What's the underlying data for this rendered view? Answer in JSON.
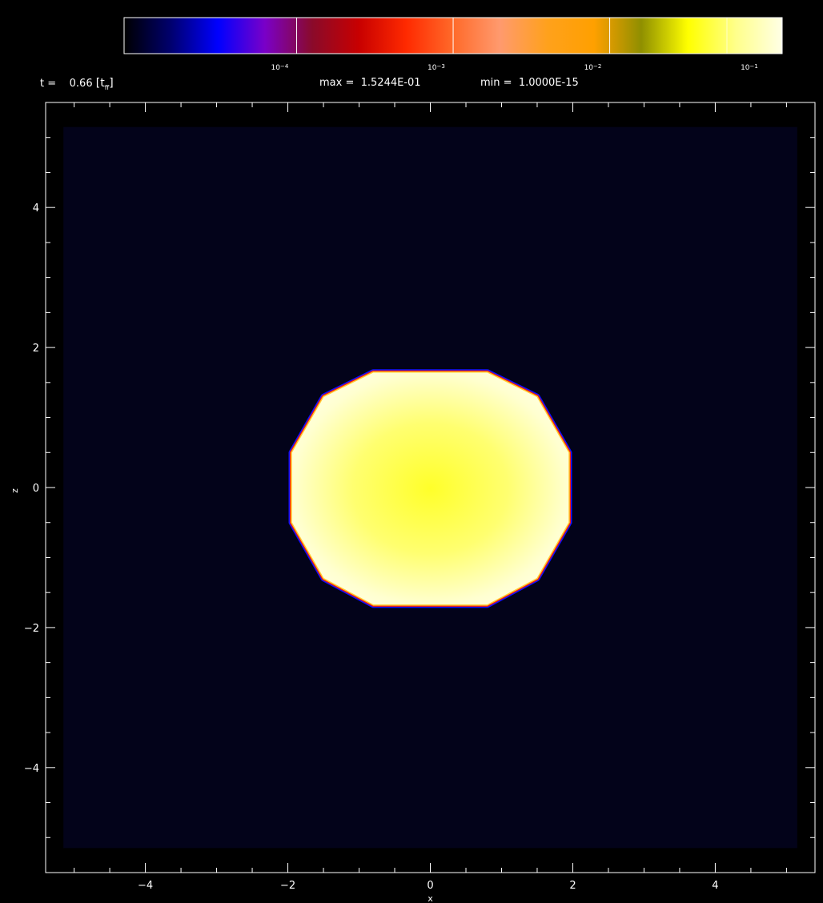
{
  "header": {
    "time_prefix": "t =",
    "time_value": "0.66",
    "time_unit_open": "[t",
    "time_unit_sub": "ff",
    "time_unit_close": "]",
    "max_label": "max =",
    "max_value": "1.5244E-01",
    "min_label": "min =",
    "min_value": "1.0000E-15"
  },
  "colorbar": {
    "scale": "log",
    "range": [
      1e-05,
      0.16
    ],
    "stops": [
      "#000000",
      "#00006e",
      "#0000ff",
      "#7a00c8",
      "#8a0a2a",
      "#c80000",
      "#ff2a00",
      "#ff6a2a",
      "#ff9a6e",
      "#ffa11c",
      "#ffa000",
      "#8f8f00",
      "#ffff00",
      "#ffff8a",
      "#ffffe6"
    ],
    "ticks": [
      {
        "base": "10",
        "exp": "−4",
        "value": 0.0001
      },
      {
        "base": "10",
        "exp": "−3",
        "value": 0.001
      },
      {
        "base": "10",
        "exp": "−2",
        "value": 0.01
      },
      {
        "base": "10",
        "exp": "−1",
        "value": 0.1
      }
    ]
  },
  "chart_data": {
    "type": "heatmap",
    "title": "",
    "xlabel": "x",
    "ylabel": "z",
    "xlim": [
      -5.4,
      5.4
    ],
    "ylim": [
      -5.5,
      5.5
    ],
    "xticks": [
      -4,
      -2,
      0,
      2,
      4
    ],
    "yticks": [
      -4,
      -2,
      0,
      2,
      4
    ],
    "xticklabels": [
      "−4",
      "−2",
      "0",
      "2",
      "4"
    ],
    "yticklabels": [
      "−4",
      "−2",
      "0",
      "2",
      "4"
    ],
    "grid": false,
    "domain": {
      "x": [
        -5.15,
        5.15
      ],
      "z": [
        -5.15,
        5.15
      ]
    },
    "background_value": 1e-05,
    "object": {
      "shape": "rounded-rectangle",
      "center": [
        0,
        0
      ],
      "vertices": [
        [
          -0.8,
          1.65
        ],
        [
          0.8,
          1.65
        ],
        [
          1.5,
          1.3
        ],
        [
          1.95,
          0.5
        ],
        [
          1.95,
          -0.5
        ],
        [
          1.5,
          -1.3
        ],
        [
          0.8,
          -1.68
        ],
        [
          -0.8,
          -1.68
        ],
        [
          -1.5,
          -1.3
        ],
        [
          -1.95,
          -0.5
        ],
        [
          -1.95,
          0.5
        ],
        [
          -1.5,
          1.3
        ]
      ],
      "core_value": 0.1524,
      "edge_value": 0.16
    },
    "colormap": "blue-red-yellow-white"
  }
}
